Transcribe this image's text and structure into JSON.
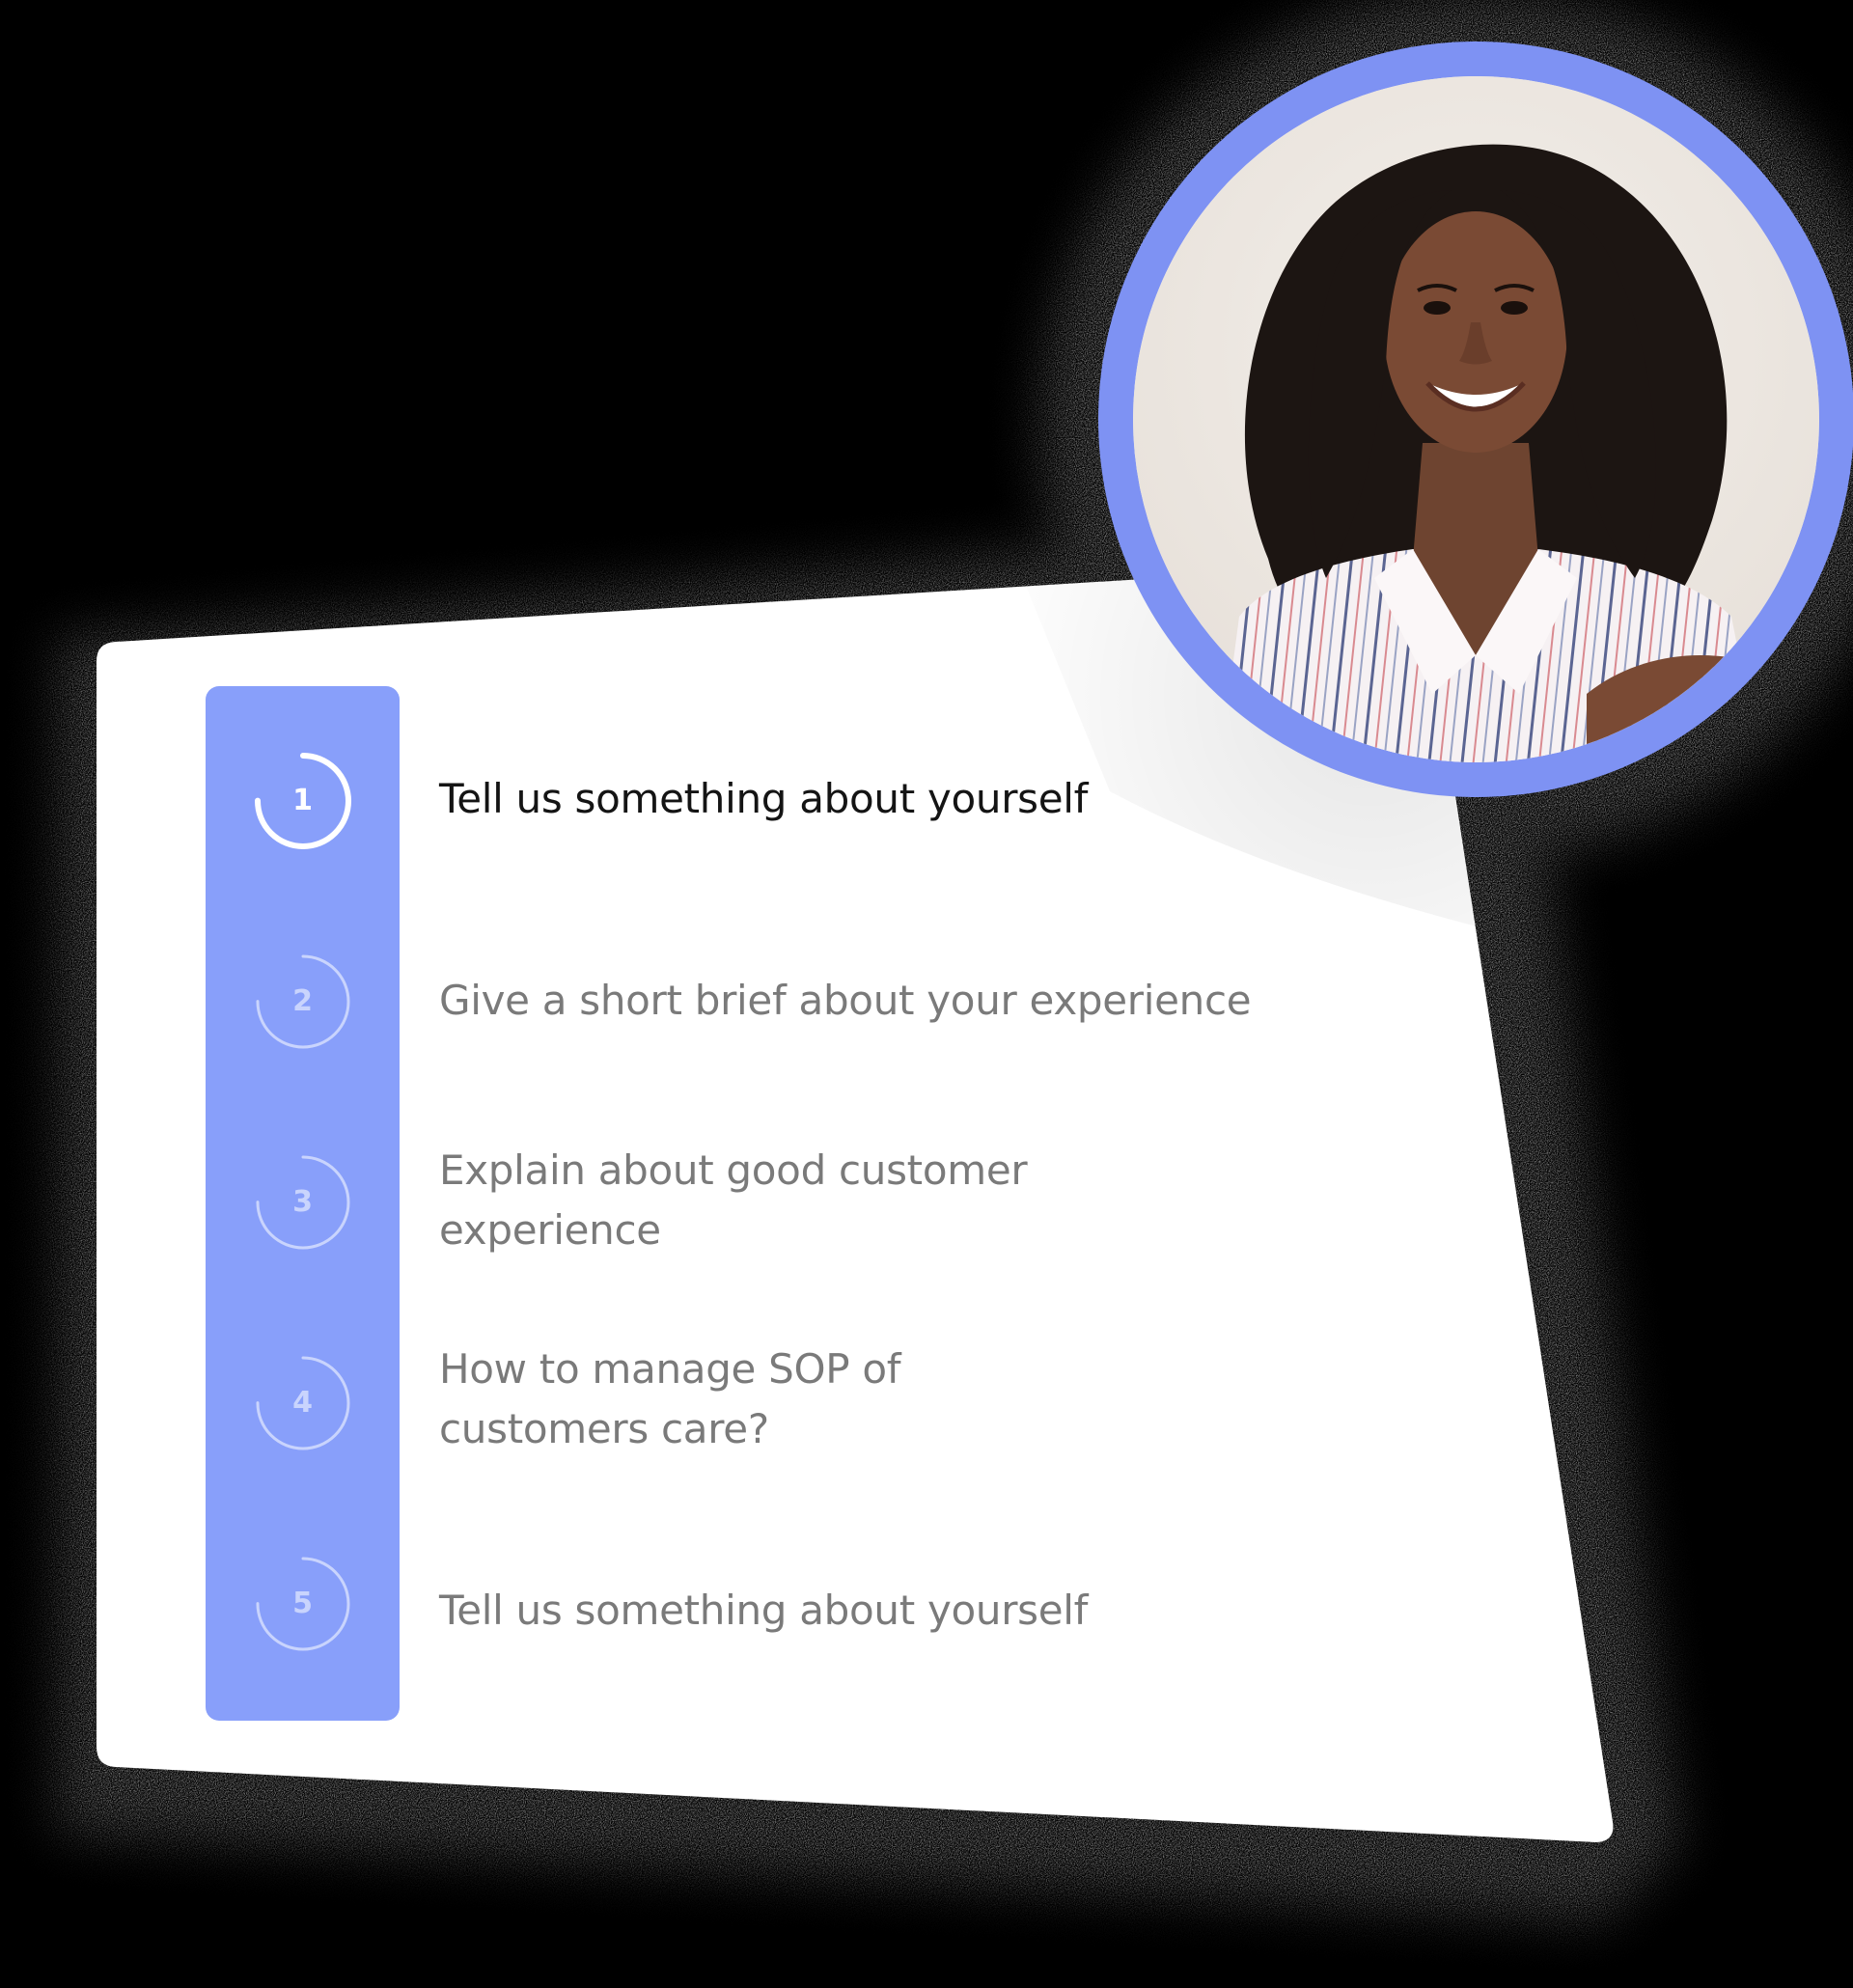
{
  "colors": {
    "accent": "#889ffa",
    "ring": "#7e92f3",
    "active_text": "#141414",
    "inactive_text": "#7a7a7a",
    "panel_bg": "#ffffff"
  },
  "steps": [
    {
      "number": "1",
      "question": "Tell us something about yourself",
      "active": true,
      "progress": 0.75
    },
    {
      "number": "2",
      "question": "Give a short brief about your experience",
      "active": false,
      "progress": 0.75
    },
    {
      "number": "3",
      "question": "Explain about good customer experience",
      "active": false,
      "progress": 0.75
    },
    {
      "number": "4",
      "question": "How to manage SOP of customers care?",
      "active": false,
      "progress": 0.75
    },
    {
      "number": "5",
      "question": "Tell us something about yourself",
      "active": false,
      "progress": 0.75
    }
  ],
  "avatar": {
    "icon": "profile-photo"
  }
}
